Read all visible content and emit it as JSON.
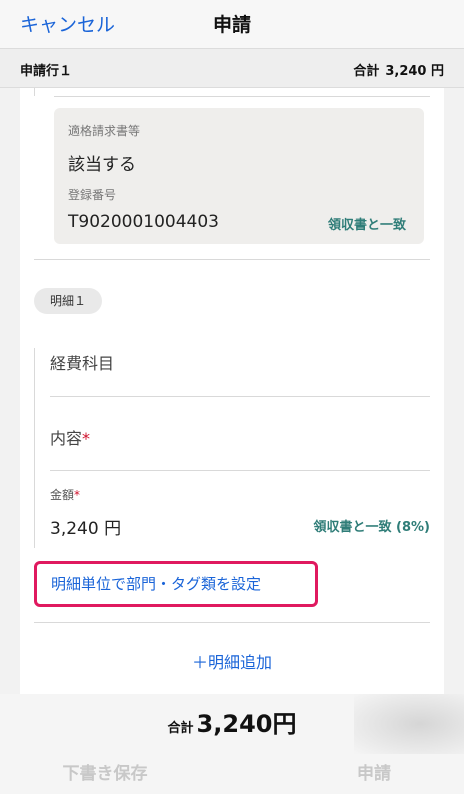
{
  "nav": {
    "cancel": "キャンセル",
    "title": "申請"
  },
  "subheader": {
    "row_label": "申請行１",
    "total_label": "合計",
    "total_value": "3,240 円"
  },
  "invoice": {
    "qualified_label": "適格請求書等",
    "qualified_value": "該当する",
    "reg_label": "登録番号",
    "reg_value": "T9020001004403",
    "reg_match": "領収書と一致"
  },
  "detail": {
    "badge": "明細１",
    "account_label": "経費科目",
    "content_label": "内容",
    "required_mark": "*",
    "amount_label": "金額",
    "amount_value": "3,240 円",
    "amount_match": "領収書と一致 (8%)",
    "setting_link": "明細単位で部門・タグ類を設定",
    "add_link": "＋明細追加"
  },
  "footer": {
    "total_label": "合計",
    "total_value": "3,240円",
    "draft_button": "下書き保存",
    "submit_button": "申請"
  },
  "colors": {
    "link": "#1a64d8",
    "match": "#2f7d78",
    "required": "#d0112b",
    "highlight": "#e0195f"
  }
}
